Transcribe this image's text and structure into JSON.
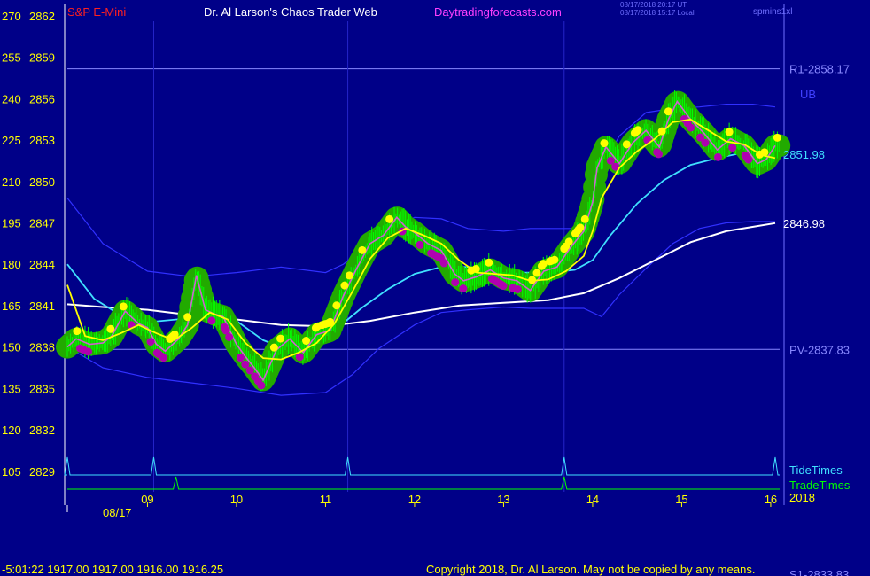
{
  "header": {
    "instrument": "S&P E-Mini",
    "title": "Dr. Al Larson's Chaos Trader Web",
    "site": "Daytradingforecasts.com",
    "timestamp_ut": "08/17/2018 20:17 UT",
    "timestamp_local": "08/17/2018 15:17 Local",
    "chart_id": "spmins1xl"
  },
  "footer": {
    "status": "-5:01:22  1917.00 1917.00 1916.00 1916.25",
    "copyright": "Copyright 2018, Dr. Al Larson. May not be copied by any means.",
    "s1_label": "S1-2833.83"
  },
  "colors": {
    "background": "#000088",
    "axis_text": "#ffff00",
    "instrument": "#ff2020",
    "title": "#ffffff",
    "site": "#ff40ff",
    "level_line": "#8888ff",
    "tide": "#40e0ff",
    "trade": "#00ff00",
    "band": "#3030ff",
    "ema_fast": "#ffff00",
    "ema_mid": "#40e0ff",
    "ema_slow": "#ffffff",
    "bar_halo": "#22aa00",
    "bar": "#00ff00",
    "dot_up": "#ffff00",
    "dot_down": "#b000b0"
  },
  "chart_data": {
    "type": "line",
    "title": "S&P E-Mini",
    "xlabel": "",
    "ylabel": "",
    "x_ticks": [
      "09",
      "10",
      "11",
      "12",
      "13",
      "14",
      "15",
      "16"
    ],
    "x_tick_hours": [
      9,
      10,
      11,
      12,
      13,
      14,
      15,
      16
    ],
    "x_range": [
      8.1,
      16.1
    ],
    "date_label": "08/17",
    "year_label": "2018",
    "ylim": [
      2826.8,
      2862.0
    ],
    "y_ticks_price": [
      2862,
      2859,
      2856,
      2853,
      2850,
      2847,
      2844,
      2841,
      2838,
      2835,
      2832,
      2829
    ],
    "y_ticks_alt": [
      270,
      255,
      240,
      225,
      210,
      195,
      180,
      165,
      150,
      135,
      120,
      105
    ],
    "levels": [
      {
        "label": "R1-2858.17",
        "value": 2858.17
      },
      {
        "label": "PV-2837.83",
        "value": 2837.83
      }
    ],
    "right_labels": [
      {
        "text": "UB",
        "value": 2855.4
      },
      {
        "text": "2851.98",
        "value": 2851.98
      },
      {
        "text": "2846.98",
        "value": 2846.98
      }
    ],
    "series": [
      {
        "name": "price",
        "x": [
          8.1,
          8.2,
          8.35,
          8.5,
          8.6,
          8.75,
          8.9,
          9.0,
          9.1,
          9.2,
          9.35,
          9.45,
          9.55,
          9.65,
          9.75,
          9.85,
          10.0,
          10.1,
          10.2,
          10.3,
          10.45,
          10.6,
          10.75,
          10.9,
          11.05,
          11.2,
          11.35,
          11.5,
          11.65,
          11.8,
          11.9,
          12.0,
          12.15,
          12.3,
          12.45,
          12.55,
          12.7,
          12.85,
          13.0,
          13.15,
          13.3,
          13.45,
          13.6,
          13.75,
          13.9,
          14.0,
          14.05,
          14.15,
          14.3,
          14.45,
          14.6,
          14.75,
          14.85,
          14.95,
          15.1,
          15.25,
          15.4,
          15.55,
          15.7,
          15.85,
          15.95,
          16.05
        ],
        "values": [
          2838.0,
          2838.6,
          2838.2,
          2838.3,
          2838.8,
          2840.6,
          2839.7,
          2839.4,
          2838.2,
          2837.7,
          2838.6,
          2839.6,
          2843.2,
          2840.7,
          2840.4,
          2840.2,
          2838.2,
          2837.3,
          2836.5,
          2835.6,
          2837.8,
          2838.6,
          2837.6,
          2838.9,
          2839.2,
          2841.7,
          2843.7,
          2845.5,
          2846.1,
          2847.4,
          2846.7,
          2846.3,
          2845.5,
          2845.0,
          2843.3,
          2842.8,
          2843.1,
          2843.6,
          2843.0,
          2842.8,
          2842.1,
          2843.5,
          2843.8,
          2845.2,
          2846.4,
          2848.5,
          2851.0,
          2852.5,
          2851.3,
          2852.8,
          2853.7,
          2852.5,
          2854.5,
          2855.8,
          2854.5,
          2853.5,
          2852.3,
          2853.1,
          2852.6,
          2851.3,
          2851.6,
          2852.6
        ]
      },
      {
        "name": "fast",
        "x": [
          8.1,
          8.3,
          8.5,
          8.7,
          8.9,
          9.1,
          9.3,
          9.5,
          9.7,
          9.9,
          10.1,
          10.3,
          10.5,
          10.7,
          10.9,
          11.1,
          11.3,
          11.5,
          11.7,
          11.9,
          12.1,
          12.3,
          12.5,
          12.7,
          12.9,
          13.1,
          13.3,
          13.5,
          13.7,
          13.9,
          14.0,
          14.1,
          14.3,
          14.5,
          14.7,
          14.9,
          15.1,
          15.3,
          15.5,
          15.7,
          15.9,
          16.05
        ],
        "values": [
          2842.5,
          2838.8,
          2838.5,
          2839.0,
          2839.6,
          2839.0,
          2838.5,
          2839.4,
          2840.5,
          2840.0,
          2838.3,
          2837.2,
          2837.1,
          2837.6,
          2838.3,
          2839.7,
          2842.0,
          2844.4,
          2845.9,
          2846.6,
          2846.1,
          2845.5,
          2844.3,
          2843.4,
          2843.3,
          2843.2,
          2842.8,
          2842.9,
          2843.5,
          2844.6,
          2846.4,
          2848.8,
          2851.0,
          2852.2,
          2853.1,
          2854.3,
          2854.5,
          2853.7,
          2852.9,
          2852.7,
          2851.9,
          2851.7
        ]
      },
      {
        "name": "medium",
        "x": [
          8.1,
          8.4,
          8.7,
          9.0,
          9.5,
          10.0,
          10.3,
          10.5,
          10.8,
          11.1,
          11.4,
          11.7,
          12.0,
          12.3,
          12.6,
          12.9,
          13.2,
          13.5,
          13.8,
          14.0,
          14.2,
          14.5,
          14.8,
          15.1,
          15.4,
          15.7,
          16.05
        ],
        "values": [
          2844.0,
          2841.5,
          2840.3,
          2839.8,
          2840.1,
          2839.9,
          2838.5,
          2838.0,
          2838.2,
          2839.2,
          2840.8,
          2842.2,
          2843.3,
          2843.8,
          2843.8,
          2843.6,
          2843.4,
          2843.4,
          2843.6,
          2844.3,
          2846.1,
          2848.4,
          2850.1,
          2851.2,
          2851.7,
          2852.1,
          2852.0
        ]
      },
      {
        "name": "slow",
        "x": [
          8.1,
          8.5,
          9.0,
          9.5,
          10.0,
          10.5,
          11.0,
          11.5,
          12.0,
          12.5,
          13.0,
          13.5,
          13.9,
          14.3,
          14.7,
          15.1,
          15.5,
          16.05
        ],
        "values": [
          2841.1,
          2840.9,
          2840.7,
          2840.3,
          2840.0,
          2839.6,
          2839.5,
          2839.9,
          2840.5,
          2841.0,
          2841.2,
          2841.4,
          2841.9,
          2843.0,
          2844.3,
          2845.6,
          2846.4,
          2846.98
        ]
      },
      {
        "name": "upper_band",
        "x": [
          8.1,
          8.5,
          9.0,
          9.5,
          10.0,
          10.5,
          11.0,
          11.2,
          11.6,
          12.0,
          12.3,
          12.6,
          13.0,
          13.3,
          13.6,
          13.8,
          13.95,
          14.05,
          14.3,
          14.6,
          14.9,
          15.2,
          15.5,
          15.8,
          16.05
        ],
        "values": [
          2848.8,
          2845.5,
          2843.5,
          2843.1,
          2843.4,
          2843.8,
          2843.4,
          2844.0,
          2846.1,
          2847.4,
          2847.3,
          2846.6,
          2846.4,
          2846.6,
          2846.6,
          2846.6,
          2848.0,
          2850.4,
          2853.3,
          2855.0,
          2855.3,
          2855.4,
          2855.6,
          2855.6,
          2855.4
        ]
      },
      {
        "name": "lower_band",
        "x": [
          8.1,
          8.5,
          9.0,
          9.5,
          10.0,
          10.5,
          11.0,
          11.3,
          11.6,
          12.0,
          12.3,
          12.6,
          13.0,
          13.3,
          13.6,
          13.9,
          14.1,
          14.3,
          14.6,
          14.9,
          15.2,
          15.5,
          15.8,
          16.05
        ],
        "values": [
          2838.0,
          2836.5,
          2835.8,
          2835.4,
          2835.0,
          2834.5,
          2834.7,
          2836.0,
          2837.9,
          2839.6,
          2840.5,
          2840.7,
          2840.9,
          2840.8,
          2840.8,
          2840.8,
          2840.2,
          2841.8,
          2843.7,
          2845.5,
          2846.6,
          2847.0,
          2847.1,
          2847.1
        ]
      }
    ],
    "tide_times": [
      8.1,
      9.07,
      11.25,
      13.68,
      16.05
    ],
    "trade_times": [
      9.32,
      13.68
    ]
  }
}
